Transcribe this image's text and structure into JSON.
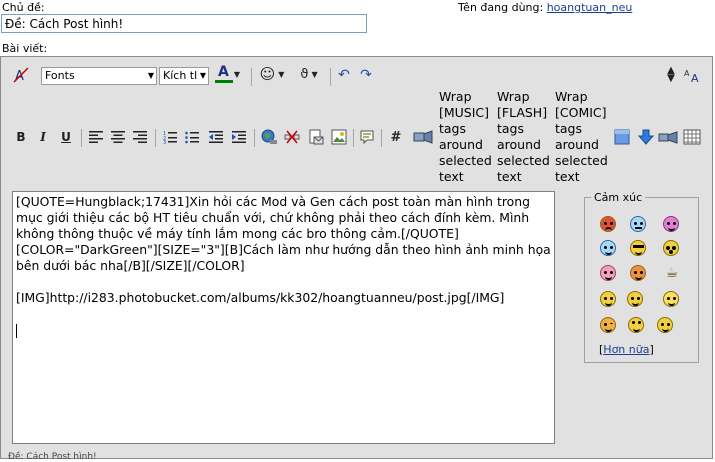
{
  "subject": {
    "label": "Chủ đề:",
    "value": "Đề: Cách Post hình!"
  },
  "user": {
    "label": "Tên đang dùng:",
    "name": "hoangtuan_neu"
  },
  "message": {
    "label": "Bài viết:"
  },
  "toolbar": {
    "font_select": "Fonts",
    "size_select": "Kích tl",
    "text_color_glyph": "A",
    "color_accent": "#008000",
    "wrap_music": "Wrap [MUSIC] tags around selected text",
    "wrap_flash": "Wrap [FLASH] tags around selected text",
    "wrap_comic": "Wrap [COMIC] tags around selected text",
    "bold": "B",
    "italic": "I",
    "underline": "U",
    "hash": "#"
  },
  "editor": {
    "content": "[QUOTE=Hungblack;17431]Xin hỏi các Mod và Gen cách post toàn màn hình trong mục giới thiệu các bộ HT tiêu chuẩn với, chứ không phải theo cách đính kèm. Mình không thông thuộc về máy tính lắm mong các bro thông cảm.[/QUOTE]\n[COLOR=\"DarkGreen\"][SIZE=\"3\"][B]Cách làm như hướng dẫn theo hình ảnh minh họa bên dưới bác nha[/B][/SIZE][/COLOR]\n\n[IMG]http://i283.photobucket.com/albums/kk302/hoangtuanneu/post.jpg[/IMG]\n\n"
  },
  "smilies": {
    "legend": "Cảm xúc",
    "more_link": "Hơn nữa",
    "items": [
      "mad-icon",
      "confused-icon",
      "tongue-icon",
      "cool-icon",
      "sunglasses-icon",
      "eek-icon",
      "pig-icon",
      "angry-icon",
      "coffee-icon",
      "smile-icon",
      "grin-icon",
      "angel-icon",
      "wink-icon",
      "roll-icon",
      "thumbs-icon"
    ]
  },
  "footer": {
    "text": "Đề: Cách Post hình!"
  }
}
